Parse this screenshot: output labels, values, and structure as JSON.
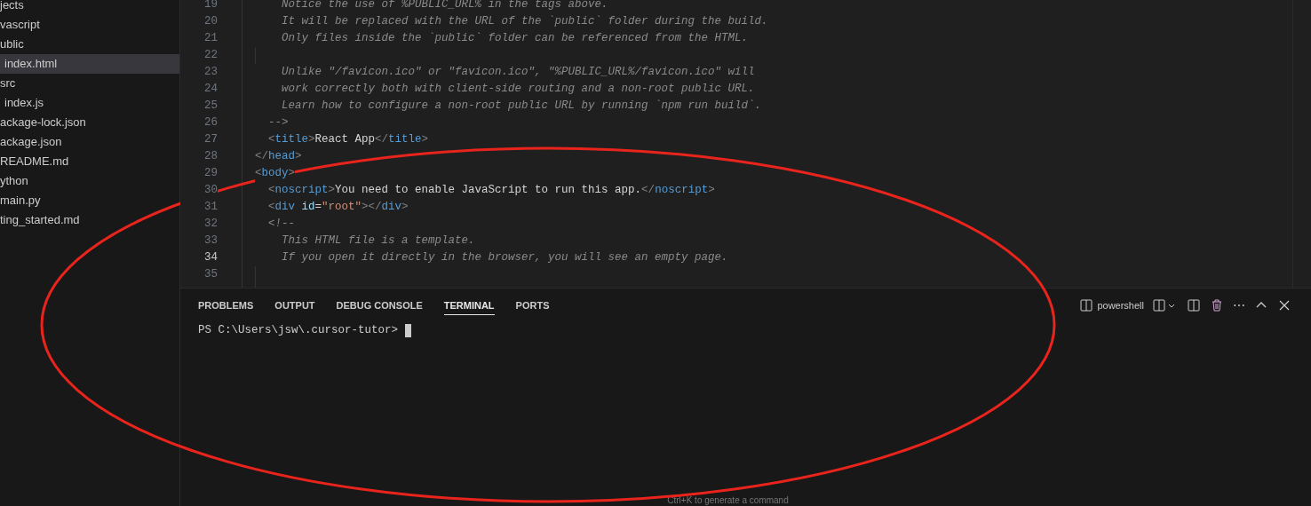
{
  "sidebar": {
    "items": [
      {
        "label": "jects",
        "selected": false
      },
      {
        "label": "vascript",
        "selected": false
      },
      {
        "label": "ublic",
        "selected": false,
        "children": [
          {
            "label": "index.html",
            "selected": true
          }
        ]
      },
      {
        "label": "src",
        "selected": false,
        "children": [
          {
            "label": "index.js",
            "selected": false
          }
        ]
      },
      {
        "label": "ackage-lock.json",
        "selected": false
      },
      {
        "label": "ackage.json",
        "selected": false
      },
      {
        "label": "README.md",
        "selected": false
      },
      {
        "label": "ython",
        "selected": false
      },
      {
        "label": "main.py",
        "selected": false
      },
      {
        "label": "ting_started.md",
        "selected": false
      }
    ]
  },
  "editor": {
    "lines": [
      {
        "number": "19",
        "current": false,
        "tokens": [
          {
            "kind": "comment",
            "text": "    Notice the use of %PUBLIC_URL% in the tags above."
          }
        ]
      },
      {
        "number": "20",
        "current": false,
        "tokens": [
          {
            "kind": "comment",
            "text": "    It will be replaced with the URL of the `public` folder during the build."
          }
        ]
      },
      {
        "number": "21",
        "current": false,
        "tokens": [
          {
            "kind": "comment",
            "text": "    Only files inside the `public` folder can be referenced from the HTML."
          }
        ]
      },
      {
        "number": "22",
        "current": false
      },
      {
        "number": "23",
        "current": false,
        "tokens": [
          {
            "kind": "comment",
            "text": "    Unlike \"/favicon.ico\" or \"favicon.ico\", \"%PUBLIC_URL%/favicon.ico\" will"
          }
        ]
      },
      {
        "number": "24",
        "current": false,
        "tokens": [
          {
            "kind": "comment",
            "text": "    work correctly both with client-side routing and a non-root public URL."
          }
        ]
      },
      {
        "number": "25",
        "current": false,
        "tokens": [
          {
            "kind": "comment",
            "text": "    Learn how to configure a non-root public URL by running `npm run build`."
          }
        ]
      },
      {
        "number": "26",
        "current": false,
        "tokens": [
          {
            "kind": "comment",
            "text": "  -->"
          }
        ]
      },
      {
        "number": "27",
        "current": false,
        "tokens": [
          {
            "kind": "punct",
            "text": "  <"
          },
          {
            "kind": "tag",
            "text": "title"
          },
          {
            "kind": "punct",
            "text": ">"
          },
          {
            "kind": "text",
            "text": "React App"
          },
          {
            "kind": "punct",
            "text": "</"
          },
          {
            "kind": "tag",
            "text": "title"
          },
          {
            "kind": "punct",
            "text": ">"
          }
        ]
      },
      {
        "number": "28",
        "current": false,
        "tokens": [
          {
            "kind": "punct",
            "text": "</"
          },
          {
            "kind": "tag",
            "text": "head"
          },
          {
            "kind": "punct",
            "text": ">"
          }
        ]
      },
      {
        "number": "29",
        "current": false,
        "tokens": [
          {
            "kind": "punct",
            "text": "<"
          },
          {
            "kind": "tag",
            "text": "body"
          },
          {
            "kind": "punct",
            "text": ">"
          }
        ]
      },
      {
        "number": "30",
        "current": false,
        "tokens": [
          {
            "kind": "punct",
            "text": "  <"
          },
          {
            "kind": "tag",
            "text": "noscript"
          },
          {
            "kind": "punct",
            "text": ">"
          },
          {
            "kind": "text",
            "text": "You need to enable JavaScript to run this app."
          },
          {
            "kind": "punct",
            "text": "</"
          },
          {
            "kind": "tag",
            "text": "noscript"
          },
          {
            "kind": "punct",
            "text": ">"
          }
        ]
      },
      {
        "number": "31",
        "current": false,
        "tokens": [
          {
            "kind": "punct",
            "text": "  <"
          },
          {
            "kind": "tag",
            "text": "div"
          },
          {
            "kind": "attr",
            "text": " id"
          },
          {
            "kind": "text",
            "text": "="
          },
          {
            "kind": "string",
            "text": "\"root\""
          },
          {
            "kind": "punct",
            "text": "></"
          },
          {
            "kind": "tag",
            "text": "div"
          },
          {
            "kind": "punct",
            "text": ">"
          }
        ]
      },
      {
        "number": "32",
        "current": false,
        "tokens": [
          {
            "kind": "comment",
            "text": "  <!--"
          }
        ]
      },
      {
        "number": "33",
        "current": false,
        "tokens": [
          {
            "kind": "comment",
            "text": "    This HTML file is a template."
          }
        ]
      },
      {
        "number": "34",
        "current": true,
        "tokens": [
          {
            "kind": "comment",
            "text": "    If you open it directly in the browser, you will see an empty page."
          }
        ]
      },
      {
        "number": "35",
        "current": false
      }
    ]
  },
  "panel": {
    "tabs": [
      {
        "label": "PROBLEMS",
        "selected": false
      },
      {
        "label": "OUTPUT",
        "selected": false
      },
      {
        "label": "DEBUG CONSOLE",
        "selected": false
      },
      {
        "label": "TERMINAL",
        "selected": true
      },
      {
        "label": "PORTS",
        "selected": false
      }
    ],
    "shell": "powershell",
    "more": "⋯",
    "prompt": "PS C:\\Users\\jsw\\.cursor-tutor>",
    "hint": "Ctrl+K to generate a command"
  },
  "annotation": {
    "kind": "ellipse"
  }
}
